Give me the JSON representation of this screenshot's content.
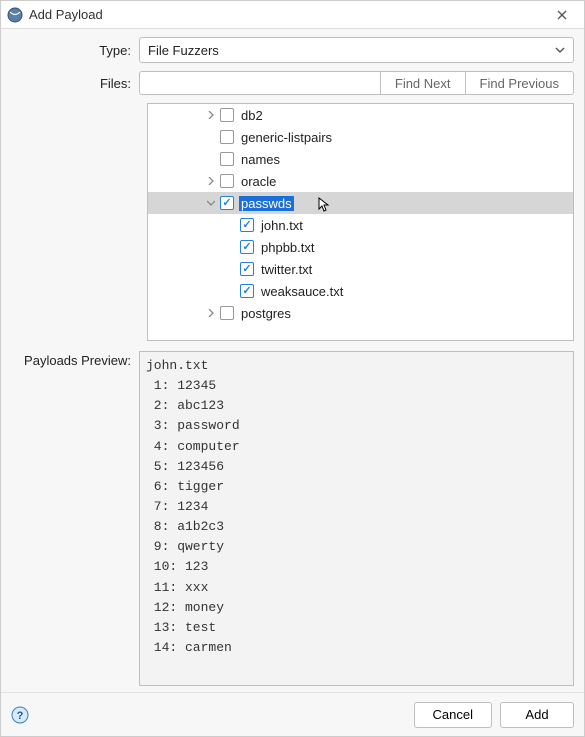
{
  "window": {
    "title": "Add Payload"
  },
  "type_row": {
    "label": "Type:",
    "selected": "File Fuzzers"
  },
  "files_row": {
    "label": "Files:",
    "search_value": "",
    "find_next": "Find Next",
    "find_prev": "Find Previous"
  },
  "tree": [
    {
      "indent": 56,
      "toggle": "collapsed",
      "checked": false,
      "label": "db2",
      "selected": false
    },
    {
      "indent": 56,
      "toggle": "none",
      "checked": false,
      "label": "generic-listpairs",
      "selected": false
    },
    {
      "indent": 56,
      "toggle": "none",
      "checked": false,
      "label": "names",
      "selected": false
    },
    {
      "indent": 56,
      "toggle": "collapsed",
      "checked": false,
      "label": "oracle",
      "selected": false
    },
    {
      "indent": 56,
      "toggle": "expanded",
      "checked": true,
      "label": "passwds",
      "selected": true
    },
    {
      "indent": 76,
      "toggle": "none",
      "checked": true,
      "label": "john.txt",
      "selected": false
    },
    {
      "indent": 76,
      "toggle": "none",
      "checked": true,
      "label": "phpbb.txt",
      "selected": false
    },
    {
      "indent": 76,
      "toggle": "none",
      "checked": true,
      "label": "twitter.txt",
      "selected": false
    },
    {
      "indent": 76,
      "toggle": "none",
      "checked": true,
      "label": "weaksauce.txt",
      "selected": false
    },
    {
      "indent": 56,
      "toggle": "collapsed",
      "checked": false,
      "label": "postgres",
      "selected": false
    }
  ],
  "preview": {
    "label": "Payloads Preview:",
    "text": "john.txt\n 1: 12345\n 2: abc123\n 3: password\n 4: computer\n 5: 123456\n 6: tigger\n 7: 1234\n 8: a1b2c3\n 9: qwerty\n 10: 123\n 11: xxx\n 12: money\n 13: test\n 14: carmen"
  },
  "footer": {
    "cancel": "Cancel",
    "add": "Add"
  }
}
